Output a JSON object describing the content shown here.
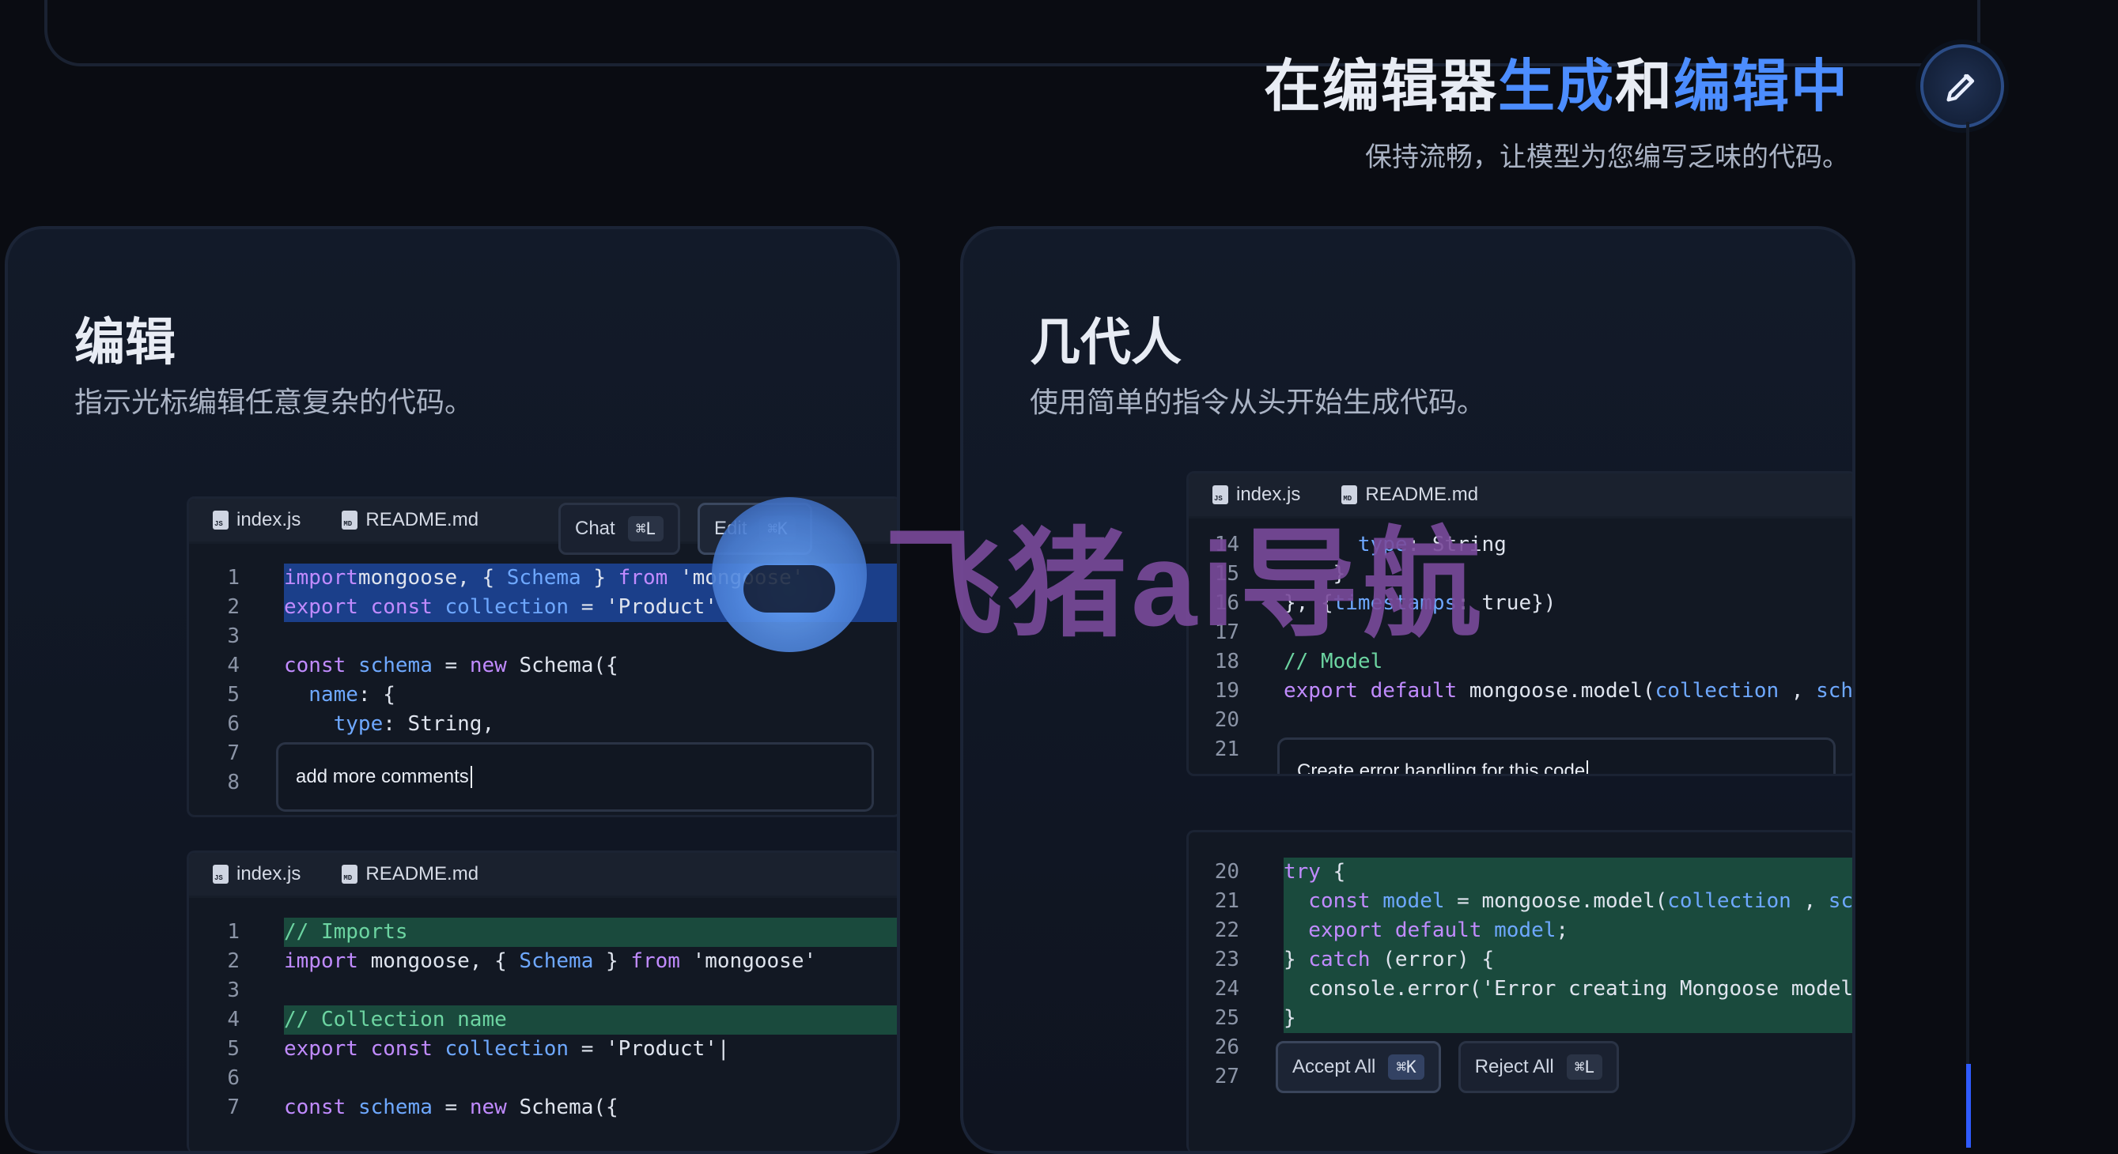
{
  "hero": {
    "title_part1": "在编辑器",
    "title_highlight1": "生成",
    "title_part2": "和",
    "title_highlight2": "编辑中",
    "subtitle": "保持流畅，让模型为您编写乏味的代码。"
  },
  "cards": {
    "left": {
      "title": "编辑",
      "desc": "指示光标编辑任意复杂的代码。"
    },
    "right": {
      "title": "几代人",
      "desc": "使用简单的指令从头开始生成代码。"
    }
  },
  "tabs": {
    "index": "index.js",
    "readme": "README.md",
    "index_badge": "JS",
    "readme_badge": "MD"
  },
  "left_panel1": {
    "chat_label": "Chat",
    "chat_kbd": "⌘L",
    "edit_label": "Edit",
    "edit_kbd": "⌘K",
    "prompt": "add more comments",
    "lines": [
      {
        "n": "1",
        "parts": [
          [
            "kw",
            "import"
          ],
          [
            "",
            "mongoose, { "
          ],
          [
            "ty",
            "Schema"
          ],
          [
            "",
            " } "
          ],
          [
            "kw",
            "from"
          ],
          [
            "",
            " 'mongoose'"
          ]
        ]
      },
      {
        "n": "2",
        "parts": [
          [
            "kw",
            "export"
          ],
          [
            "",
            " "
          ],
          [
            "kw",
            "const"
          ],
          [
            "",
            " "
          ],
          [
            "ty",
            "collection"
          ],
          [
            "",
            " = 'Product'"
          ]
        ]
      },
      {
        "n": "3",
        "parts": []
      },
      {
        "n": "4",
        "parts": [
          [
            "kw",
            "const"
          ],
          [
            "",
            " "
          ],
          [
            "ty",
            "schema"
          ],
          [
            "",
            " = "
          ],
          [
            "kw",
            "new"
          ],
          [
            "",
            " Schema({"
          ]
        ]
      },
      {
        "n": "5",
        "parts": [
          [
            "ty",
            "  name"
          ],
          [
            "",
            ": {"
          ]
        ]
      },
      {
        "n": "6",
        "parts": [
          [
            "ty",
            "    type"
          ],
          [
            "",
            ": String,"
          ]
        ]
      },
      {
        "n": "7",
        "parts": []
      },
      {
        "n": "8",
        "parts": []
      }
    ]
  },
  "left_panel2": {
    "lines": [
      {
        "n": "1",
        "parts": [
          [
            "cm",
            "// Imports"
          ]
        ]
      },
      {
        "n": "2",
        "parts": [
          [
            "kw",
            "import"
          ],
          [
            "",
            " mongoose, { "
          ],
          [
            "ty",
            "Schema"
          ],
          [
            "",
            " } "
          ],
          [
            "kw",
            "from"
          ],
          [
            "",
            " 'mongoose'"
          ]
        ]
      },
      {
        "n": "3",
        "parts": []
      },
      {
        "n": "4",
        "parts": [
          [
            "cm",
            "// Collection name"
          ]
        ]
      },
      {
        "n": "5",
        "parts": [
          [
            "kw",
            "export"
          ],
          [
            "",
            " "
          ],
          [
            "kw",
            "const"
          ],
          [
            "",
            " "
          ],
          [
            "ty",
            "collection"
          ],
          [
            "",
            " = 'Product'|"
          ]
        ]
      },
      {
        "n": "6",
        "parts": []
      },
      {
        "n": "7",
        "parts": [
          [
            "kw",
            "const"
          ],
          [
            "",
            " "
          ],
          [
            "ty",
            "schema"
          ],
          [
            "",
            " = "
          ],
          [
            "kw",
            "new"
          ],
          [
            "",
            " Schema({"
          ]
        ]
      }
    ]
  },
  "right_panel1": {
    "prompt": "Create error handling for this code",
    "lines": [
      {
        "n": "14",
        "parts": [
          [
            "ty",
            "      type"
          ],
          [
            "",
            ": String"
          ]
        ]
      },
      {
        "n": "15",
        "parts": [
          [
            "",
            "    }"
          ]
        ]
      },
      {
        "n": "16",
        "parts": [
          [
            "",
            "}, {"
          ],
          [
            "ty",
            "timestamps"
          ],
          [
            "",
            ": true})"
          ]
        ]
      },
      {
        "n": "17",
        "parts": []
      },
      {
        "n": "18",
        "parts": [
          [
            "cm",
            "// Model"
          ]
        ]
      },
      {
        "n": "19",
        "parts": [
          [
            "kw",
            "export default"
          ],
          [
            "",
            " mongoose.model("
          ],
          [
            "ty",
            "collection"
          ],
          [
            "",
            " , "
          ],
          [
            "ty",
            "schema"
          ]
        ]
      },
      {
        "n": "20",
        "parts": []
      },
      {
        "n": "21",
        "parts": []
      }
    ]
  },
  "right_panel2": {
    "accept_label": "Accept All",
    "accept_kbd": "⌘K",
    "reject_label": "Reject All",
    "reject_kbd": "⌘L",
    "lines": [
      {
        "n": "20",
        "parts": [
          [
            "kw",
            "try"
          ],
          [
            "",
            " {"
          ]
        ]
      },
      {
        "n": "21",
        "parts": [
          [
            "kw",
            "  const"
          ],
          [
            "",
            " "
          ],
          [
            "ty",
            "model"
          ],
          [
            "",
            " = mongoose.model("
          ],
          [
            "ty",
            "collection"
          ],
          [
            "",
            " , "
          ],
          [
            "ty",
            "schem"
          ]
        ]
      },
      {
        "n": "22",
        "parts": [
          [
            "kw",
            "  export default"
          ],
          [
            "",
            " "
          ],
          [
            "ty",
            "model"
          ],
          [
            "",
            ";"
          ]
        ]
      },
      {
        "n": "23",
        "parts": [
          [
            "",
            "} "
          ],
          [
            "kw",
            "catch"
          ],
          [
            "",
            " (error) {"
          ]
        ]
      },
      {
        "n": "24",
        "parts": [
          [
            "",
            "  console.error('Error creating Mongoose model:'"
          ]
        ]
      },
      {
        "n": "25",
        "parts": [
          [
            "",
            "}"
          ]
        ]
      },
      {
        "n": "26",
        "parts": []
      },
      {
        "n": "27",
        "parts": []
      }
    ]
  },
  "watermark": {
    "text": "飞猪ai导航"
  }
}
